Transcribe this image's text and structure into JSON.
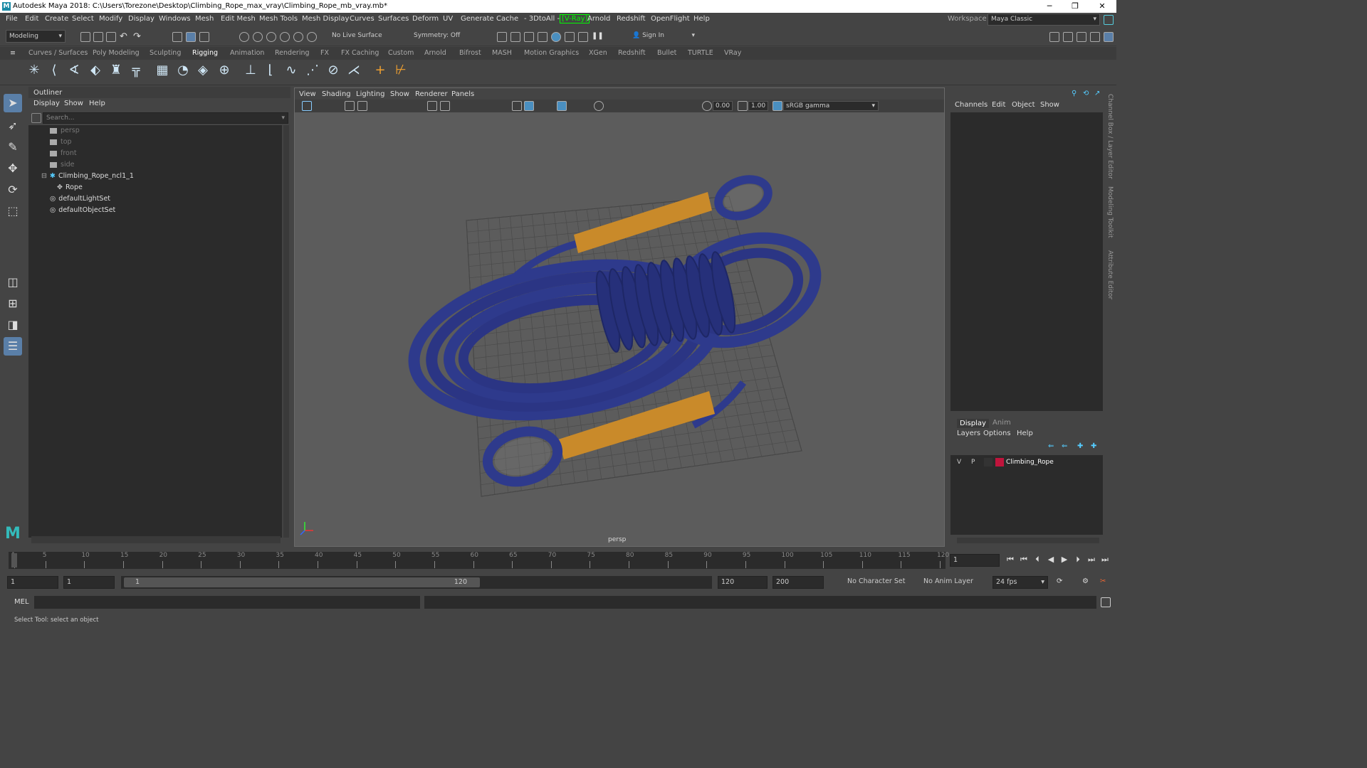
{
  "window": {
    "title": "Autodesk Maya 2018: C:\\Users\\Torezone\\Desktop\\Climbing_Rope_max_vray\\Climbing_Rope_mb_vray.mb*",
    "logo": "M"
  },
  "menubar": [
    "File",
    "Edit",
    "Create",
    "Select",
    "Modify",
    "Display",
    "Windows",
    "Mesh",
    "Edit Mesh",
    "Mesh Tools",
    "Mesh Display",
    "Curves",
    "Surfaces",
    "Deform",
    "UV",
    "Generate",
    "Cache",
    "- 3DtoAll -",
    "V-Ray",
    "Arnold",
    "Redshift",
    "OpenFlight",
    "Help"
  ],
  "workspace": {
    "label": "Workspace :",
    "value": "Maya Classic"
  },
  "toolbar": {
    "mode": "Modeling",
    "live_surface": "No Live Surface",
    "symmetry": "Symmetry: Off",
    "sign_in": "Sign In"
  },
  "shelf_tabs": [
    "Curves / Surfaces",
    "Poly Modeling",
    "Sculpting",
    "Rigging",
    "Animation",
    "Rendering",
    "FX",
    "FX Caching",
    "Custom",
    "Arnold",
    "Bifrost",
    "MASH",
    "Motion Graphics",
    "XGen",
    "Redshift",
    "Bullet",
    "TURTLE",
    "VRay"
  ],
  "active_shelf_tab": "Rigging",
  "outliner": {
    "title": "Outliner",
    "menu": [
      "Display",
      "Show",
      "Help"
    ],
    "search_placeholder": "Search...",
    "items": [
      {
        "label": "persp",
        "type": "camera"
      },
      {
        "label": "top",
        "type": "camera"
      },
      {
        "label": "front",
        "type": "camera"
      },
      {
        "label": "side",
        "type": "camera"
      },
      {
        "label": "Climbing_Rope_ncl1_1",
        "type": "group"
      },
      {
        "label": "Rope",
        "type": "mesh"
      },
      {
        "label": "defaultLightSet",
        "type": "set"
      },
      {
        "label": "defaultObjectSet",
        "type": "set"
      }
    ]
  },
  "viewport": {
    "menu": [
      "View",
      "Shading",
      "Lighting",
      "Show",
      "Renderer",
      "Panels"
    ],
    "exposure": "0.00",
    "gamma": "1.00",
    "color_space": "sRGB gamma",
    "camera_label": "persp"
  },
  "channel_box": {
    "menu": [
      "Channels",
      "Edit",
      "Object",
      "Show"
    ]
  },
  "layer_editor": {
    "tabs": [
      "Display",
      "Anim"
    ],
    "menu": [
      "Layers",
      "Options",
      "Help"
    ],
    "layer": {
      "v": "V",
      "p": "P",
      "name": "Climbing_Rope",
      "color": "#c0143c"
    }
  },
  "side_tabs": [
    "Channel Box / Layer Editor",
    "Modeling Toolkit",
    "Attribute Editor"
  ],
  "timeline": {
    "ticks": [
      "1",
      "5",
      "10",
      "15",
      "20",
      "25",
      "30",
      "35",
      "40",
      "45",
      "50",
      "55",
      "60",
      "65",
      "70",
      "75",
      "80",
      "85",
      "90",
      "95",
      "100",
      "105",
      "110",
      "115",
      "120"
    ],
    "current_frame": "1"
  },
  "range": {
    "start": "1",
    "playback_start": "1",
    "slider_start": "1",
    "slider_end": "120",
    "playback_end": "120",
    "end": "200",
    "character_set": "No Character Set",
    "anim_layer": "No Anim Layer",
    "fps": "24 fps"
  },
  "command_line": {
    "label": "MEL"
  },
  "status_line": "Select Tool: select an object",
  "colors": {
    "rope": "#2e3a8c",
    "rope_sleeve": "#c98a2a",
    "vray": "#00ff00",
    "layer_color": "#c0143c"
  }
}
